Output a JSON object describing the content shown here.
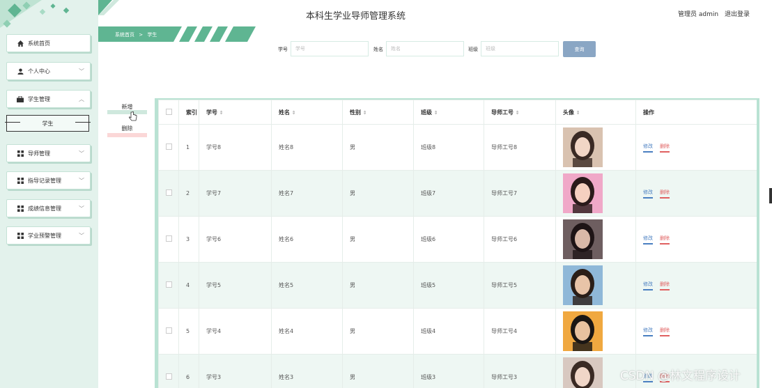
{
  "header": {
    "title": "本科生学业导师管理系统",
    "user_label": "管理员 admin",
    "logout": "退出登录"
  },
  "breadcrumb": {
    "home": "系统首页",
    "sep": ">",
    "current": "学生"
  },
  "sidebar": {
    "items": [
      {
        "label": "系统首页",
        "icon": "home-icon"
      },
      {
        "label": "个人中心",
        "icon": "person-icon"
      },
      {
        "label": "学生管理",
        "icon": "briefcase-icon"
      },
      {
        "label": "导师管理",
        "icon": "grid-icon"
      },
      {
        "label": "指导记录管理",
        "icon": "grid-icon"
      },
      {
        "label": "成绩信息管理",
        "icon": "grid-icon"
      },
      {
        "label": "学业预警管理",
        "icon": "grid-icon"
      }
    ],
    "sub_item": "学生"
  },
  "search": {
    "fields": [
      {
        "label": "学号",
        "placeholder": "学号"
      },
      {
        "label": "姓名",
        "placeholder": "姓名"
      },
      {
        "label": "班级",
        "placeholder": "班级"
      }
    ],
    "button": "查询"
  },
  "actions": {
    "add": "新增",
    "delete": "删除"
  },
  "table": {
    "headers": {
      "index": "索引",
      "student_no": "学号",
      "name": "姓名",
      "gender": "性别",
      "class": "班级",
      "tutor_no": "导师工号",
      "avatar": "头像",
      "ops": "操作"
    },
    "rows": [
      {
        "index": "1",
        "student_no": "学号8",
        "name": "姓名8",
        "gender": "男",
        "class": "班级8",
        "tutor_no": "导师工号8"
      },
      {
        "index": "2",
        "student_no": "学号7",
        "name": "姓名7",
        "gender": "男",
        "class": "班级7",
        "tutor_no": "导师工号7"
      },
      {
        "index": "3",
        "student_no": "学号6",
        "name": "姓名6",
        "gender": "男",
        "class": "班级6",
        "tutor_no": "导师工号6"
      },
      {
        "index": "4",
        "student_no": "学号5",
        "name": "姓名5",
        "gender": "男",
        "class": "班级5",
        "tutor_no": "导师工号5"
      },
      {
        "index": "5",
        "student_no": "学号4",
        "name": "姓名4",
        "gender": "男",
        "class": "班级4",
        "tutor_no": "导师工号4"
      },
      {
        "index": "6",
        "student_no": "学号3",
        "name": "姓名3",
        "gender": "男",
        "class": "班级3",
        "tutor_no": "导师工号3"
      }
    ],
    "edit_label": "修改",
    "delete_label": "删除"
  },
  "watermark": "CSDN @林文程序设计",
  "colors": {
    "accent": "#5fb592",
    "sidebar_bg": "#e3f2ec",
    "search_btn": "#8aa6c4",
    "edit": "#4a7fc1",
    "delete": "#e06060"
  }
}
